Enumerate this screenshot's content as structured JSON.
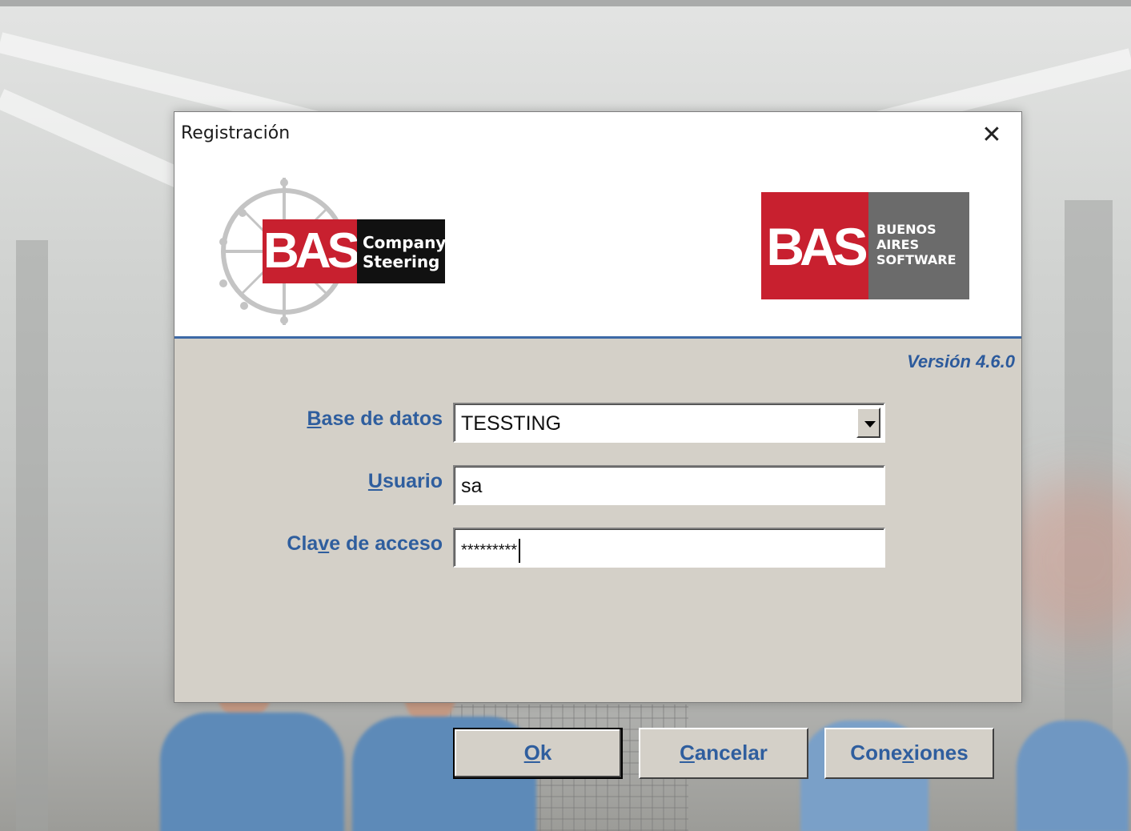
{
  "dialog": {
    "title": "Registración",
    "close_glyph": "✕"
  },
  "logos": {
    "left": {
      "bas": "BAS",
      "line1": "Company",
      "line2": "Steering"
    },
    "right": {
      "bas": "BAS",
      "line1": "BUENOS",
      "line2": "AIRES",
      "line3": "SOFTWARE"
    }
  },
  "version": "Versión 4.6.0",
  "form": {
    "database": {
      "label_accel": "B",
      "label_rest": "ase de datos",
      "value": "TESSTING"
    },
    "user": {
      "label_accel": "U",
      "label_rest": "suario",
      "value": "sa"
    },
    "password": {
      "label_pre": "Cla",
      "label_accel": "v",
      "label_rest": "e de acceso",
      "value": "*********"
    }
  },
  "buttons": {
    "ok": {
      "accel": "O",
      "rest": "k"
    },
    "cancel": {
      "accel": "C",
      "rest": "ancelar"
    },
    "connections": {
      "pre": "Cone",
      "accel": "x",
      "rest": "iones"
    }
  },
  "colors": {
    "accent_blue": "#2f5e9e",
    "bas_red": "#c8202f",
    "bas_gray": "#6b6b6b",
    "dialog_gray": "#d4d0c8"
  }
}
